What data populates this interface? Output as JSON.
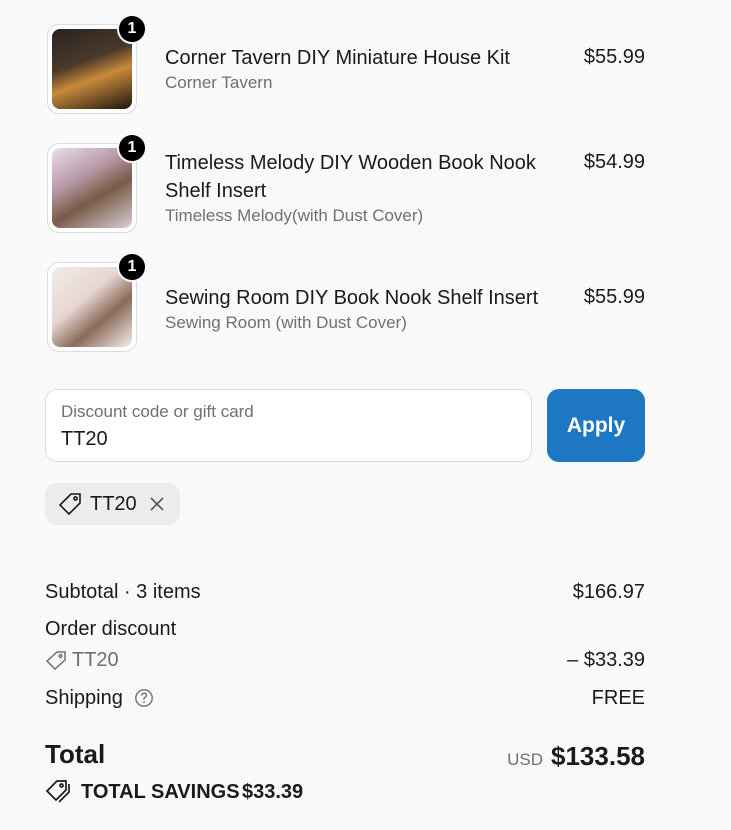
{
  "items": [
    {
      "title": "Corner Tavern DIY Miniature House Kit",
      "variant": "Corner Tavern",
      "price": "$55.99",
      "quantity": "1"
    },
    {
      "title": "Timeless Melody DIY Wooden Book Nook Shelf Insert",
      "variant": "Timeless Melody(with Dust Cover)",
      "price": "$54.99",
      "quantity": "1"
    },
    {
      "title": "Sewing Room DIY Book Nook Shelf Insert",
      "variant": "Sewing Room (with Dust Cover)",
      "price": "$55.99",
      "quantity": "1"
    }
  ],
  "discount": {
    "placeholder": "Discount code or gift card",
    "value": "TT20",
    "apply_label": "Apply",
    "applied_code": "TT20"
  },
  "summary": {
    "subtotal_label": "Subtotal · 3 items",
    "subtotal_value": "$166.97",
    "order_discount_label": "Order discount",
    "discount_code": "TT20",
    "discount_value": "– $33.39",
    "shipping_label": "Shipping",
    "shipping_value": "FREE",
    "total_label": "Total",
    "currency": "USD",
    "total_value": "$133.58",
    "savings_label": "TOTAL SAVINGS",
    "savings_value": "$33.39"
  },
  "colors": {
    "accent": "#1d77c3",
    "background": "#f9f9f9"
  }
}
